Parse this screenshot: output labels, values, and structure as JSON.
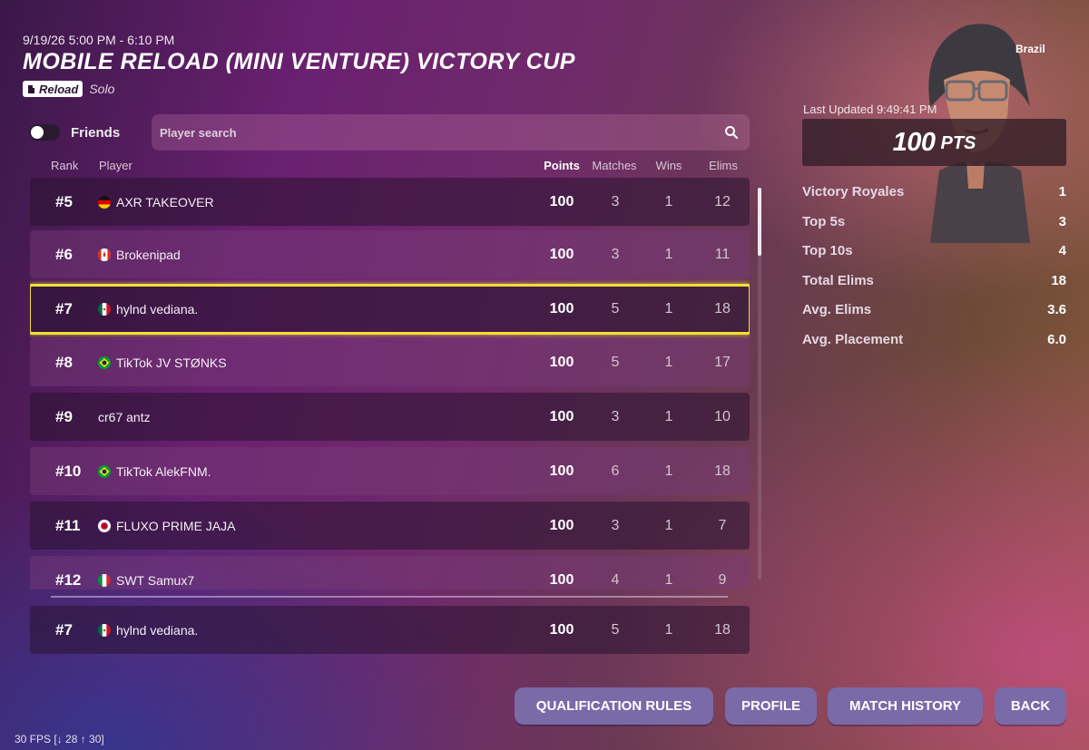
{
  "event": {
    "datetime": "9/19/26 5:00 PM  -  6:10 PM",
    "title": "MOBILE RELOAD (MINI VENTURE) VICTORY CUP",
    "mode_badge": "Reload",
    "mode": "Solo"
  },
  "filters": {
    "friends_label": "Friends",
    "friends_toggle_on": false,
    "search_placeholder": "Player search"
  },
  "table": {
    "headers": {
      "rank": "Rank",
      "player": "Player",
      "points": "Points",
      "matches": "Matches",
      "wins": "Wins",
      "elims": "Elims"
    },
    "rows": [
      {
        "rank": "#5",
        "player": "AXR TAKEOVER",
        "flag": "germany",
        "points": "100",
        "matches": "3",
        "wins": "1",
        "elims": "12",
        "style": "dark"
      },
      {
        "rank": "#6",
        "player": "Brokenipad",
        "flag": "canada",
        "points": "100",
        "matches": "3",
        "wins": "1",
        "elims": "11",
        "style": "light"
      },
      {
        "rank": "#7",
        "player": "hylnd vediana.",
        "flag": "mexico",
        "points": "100",
        "matches": "5",
        "wins": "1",
        "elims": "18",
        "style": "highlight"
      },
      {
        "rank": "#8",
        "player": "TikTok JV STØNKS",
        "flag": "brazil",
        "points": "100",
        "matches": "5",
        "wins": "1",
        "elims": "17",
        "style": "light"
      },
      {
        "rank": "#9",
        "player": "cr67 antz",
        "flag": "",
        "points": "100",
        "matches": "3",
        "wins": "1",
        "elims": "10",
        "style": "dark"
      },
      {
        "rank": "#10",
        "player": "TikTok AlekFNM.",
        "flag": "brazil",
        "points": "100",
        "matches": "6",
        "wins": "1",
        "elims": "18",
        "style": "light"
      },
      {
        "rank": "#11",
        "player": "FLUXO PRIME JAJA",
        "flag": "japan",
        "points": "100",
        "matches": "3",
        "wins": "1",
        "elims": "7",
        "style": "dark"
      },
      {
        "rank": "#12",
        "player": "SWT Samux7",
        "flag": "italy",
        "points": "100",
        "matches": "4",
        "wins": "1",
        "elims": "9",
        "style": "light"
      }
    ],
    "my_row": {
      "rank": "#7",
      "player": "hylnd vediana.",
      "flag": "mexico",
      "points": "100",
      "matches": "5",
      "wins": "1",
      "elims": "18"
    }
  },
  "profile": {
    "country": "Brazil",
    "last_updated": "Last Updated 9:49:41 PM",
    "points_value": "100",
    "points_unit": "PTS",
    "stats": [
      {
        "label": "Victory Royales",
        "value": "1"
      },
      {
        "label": "Top 5s",
        "value": "3"
      },
      {
        "label": "Top 10s",
        "value": "4"
      },
      {
        "label": "Total Elims",
        "value": "18"
      },
      {
        "label": "Avg. Elims",
        "value": "3.6"
      },
      {
        "label": "Avg. Placement",
        "value": "6.0"
      }
    ]
  },
  "buttons": {
    "qualification_rules": "QUALIFICATION RULES",
    "profile": "PROFILE",
    "match_history": "MATCH HISTORY",
    "back": "BACK"
  },
  "fps": "30 FPS [↓ 28 ↑ 30]",
  "colors": {
    "highlight_border": "#f0e030",
    "button_bg": "#7a6aa8"
  }
}
